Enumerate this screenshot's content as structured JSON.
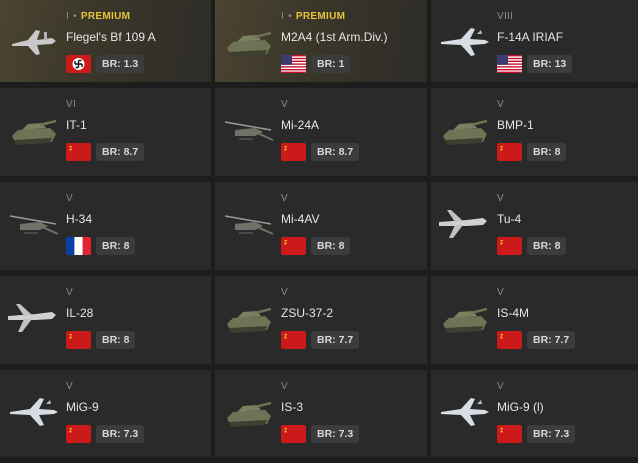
{
  "cards": [
    {
      "rank": "I",
      "premium": "PREMIUM",
      "name": "Flegel's Bf 109 A",
      "flag": "germany-flag",
      "br": "BR: 1.3",
      "type": "plane"
    },
    {
      "rank": "I",
      "premium": "PREMIUM",
      "name": "M2A4 (1st Arm.Div.)",
      "flag": "usa-flag",
      "br": "BR: 1",
      "type": "tank"
    },
    {
      "rank": "VIII",
      "premium": "",
      "name": "F-14A IRIAF",
      "flag": "usa-flag",
      "br": "BR: 13",
      "type": "jet"
    },
    {
      "rank": "VI",
      "premium": "",
      "name": "IT-1",
      "flag": "ussr-flag",
      "br": "BR: 8.7",
      "type": "tank"
    },
    {
      "rank": "V",
      "premium": "",
      "name": "Mi-24A",
      "flag": "ussr-flag",
      "br": "BR: 8.7",
      "type": "heli"
    },
    {
      "rank": "V",
      "premium": "",
      "name": "BMP-1",
      "flag": "ussr-flag",
      "br": "BR: 8",
      "type": "tank"
    },
    {
      "rank": "V",
      "premium": "",
      "name": "H-34",
      "flag": "france-flag",
      "br": "BR: 8",
      "type": "heli"
    },
    {
      "rank": "V",
      "premium": "",
      "name": "Mi-4AV",
      "flag": "ussr-flag",
      "br": "BR: 8",
      "type": "heli"
    },
    {
      "rank": "V",
      "premium": "",
      "name": "Tu-4",
      "flag": "ussr-flag",
      "br": "BR: 8",
      "type": "bomber"
    },
    {
      "rank": "V",
      "premium": "",
      "name": "IL-28",
      "flag": "ussr-flag",
      "br": "BR: 8",
      "type": "bomber"
    },
    {
      "rank": "V",
      "premium": "",
      "name": "ZSU-37-2",
      "flag": "ussr-flag",
      "br": "BR: 7.7",
      "type": "tank"
    },
    {
      "rank": "V",
      "premium": "",
      "name": "IS-4M",
      "flag": "ussr-flag",
      "br": "BR: 7.7",
      "type": "tank"
    },
    {
      "rank": "V",
      "premium": "",
      "name": "MiG-9",
      "flag": "ussr-flag",
      "br": "BR: 7.3",
      "type": "jet"
    },
    {
      "rank": "V",
      "premium": "",
      "name": "IS-3",
      "flag": "ussr-flag",
      "br": "BR: 7.3",
      "type": "tank"
    },
    {
      "rank": "V",
      "premium": "",
      "name": "MiG-9 (l)",
      "flag": "ussr-flag",
      "br": "BR: 7.3",
      "type": "jet"
    }
  ],
  "colors": {
    "background": "#1d1d1d",
    "card": "#2a2a2a",
    "premium_text": "#e9c33a",
    "br_badge": "#3c3c3c",
    "ussr_red": "#cc1a1a"
  }
}
